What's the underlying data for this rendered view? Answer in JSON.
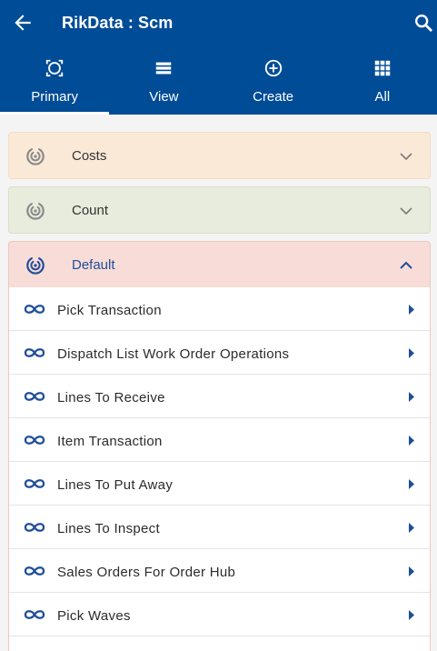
{
  "app": {
    "title": "RikData : Scm"
  },
  "icons": {
    "back": "arrow-left-icon",
    "search": "search-icon",
    "section": "target-icon",
    "item": "link-icon",
    "caret": "caret-right-icon"
  },
  "colors": {
    "header": "#004c97",
    "accent": "#1f4e99"
  },
  "tabs": [
    {
      "label": "Primary",
      "icon": "target-icon",
      "active": true
    },
    {
      "label": "View",
      "icon": "list-icon",
      "active": false
    },
    {
      "label": "Create",
      "icon": "plus-circle-icon",
      "active": false
    },
    {
      "label": "All",
      "icon": "grid-icon",
      "active": false
    }
  ],
  "sections": [
    {
      "label": "Costs",
      "expanded": false,
      "color": "#fbe9d8"
    },
    {
      "label": "Count",
      "expanded": false,
      "color": "#e8ecdd"
    },
    {
      "label": "Default",
      "expanded": true,
      "color": "#f8dcd8"
    }
  ],
  "default_items": [
    {
      "label": "Pick Transaction"
    },
    {
      "label": "Dispatch List Work Order Operations"
    },
    {
      "label": "Lines To Receive"
    },
    {
      "label": "Item Transaction"
    },
    {
      "label": "Lines To Put Away"
    },
    {
      "label": "Lines To Inspect"
    },
    {
      "label": "Sales Orders For Order Hub"
    },
    {
      "label": "Pick Waves"
    }
  ]
}
